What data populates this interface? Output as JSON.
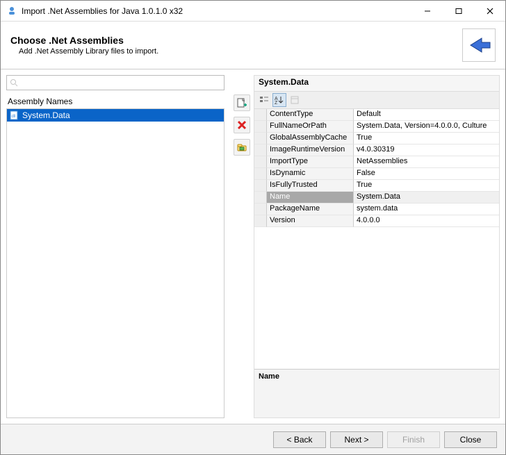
{
  "window": {
    "title": "Import .Net Assemblies for Java 1.0.1.0 x32"
  },
  "banner": {
    "title": "Choose .Net Assemblies",
    "desc": "Add .Net Assembly Library files to import."
  },
  "left": {
    "header": "Assembly Names",
    "items": [
      {
        "label": "System.Data",
        "selected": true
      }
    ],
    "search_placeholder": ""
  },
  "details": {
    "title": "System.Data",
    "selected_property": "Name",
    "properties": [
      {
        "name": "ContentType",
        "value": "Default"
      },
      {
        "name": "FullNameOrPath",
        "value": "System.Data, Version=4.0.0.0, Culture"
      },
      {
        "name": "GlobalAssemblyCache",
        "value": "True"
      },
      {
        "name": "ImageRuntimeVersion",
        "value": "v4.0.30319"
      },
      {
        "name": "ImportType",
        "value": "NetAssemblies"
      },
      {
        "name": "IsDynamic",
        "value": "False"
      },
      {
        "name": "IsFullyTrusted",
        "value": "True"
      },
      {
        "name": "Name",
        "value": "System.Data"
      },
      {
        "name": "PackageName",
        "value": "system.data"
      },
      {
        "name": "Version",
        "value": "4.0.0.0"
      }
    ],
    "desc_title": "Name"
  },
  "buttons": {
    "back": "< Back",
    "next": "Next >",
    "finish": "Finish",
    "close": "Close"
  }
}
